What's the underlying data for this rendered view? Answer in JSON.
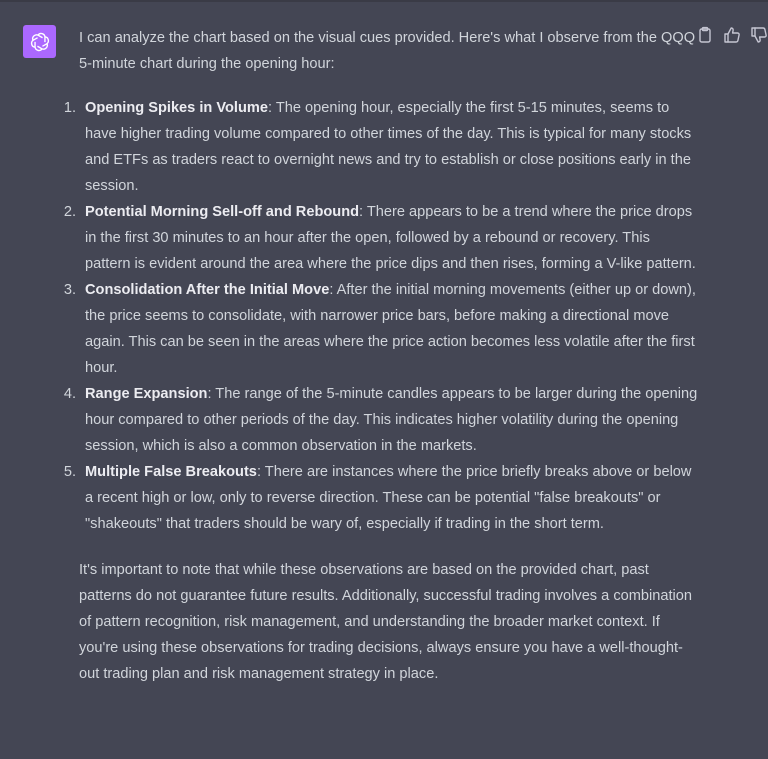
{
  "assistant": {
    "avatar_icon": "openai-logo-icon",
    "avatar_color": "#ab68ff"
  },
  "actions": {
    "copy_icon": "clipboard-icon",
    "like_icon": "thumbs-up-icon",
    "dislike_icon": "thumbs-down-icon"
  },
  "message": {
    "intro": "I can analyze the chart based on the visual cues provided. Here's what I observe from the QQQ 5-minute chart during the opening hour:",
    "points": [
      {
        "number": "1.",
        "title": "Opening Spikes in Volume",
        "text": ": The opening hour, especially the first 5-15 minutes, seems to have higher trading volume compared to other times of the day. This is typical for many stocks and ETFs as traders react to overnight news and try to establish or close positions early in the session."
      },
      {
        "number": "2.",
        "title": "Potential Morning Sell-off and Rebound",
        "text": ": There appears to be a trend where the price drops in the first 30 minutes to an hour after the open, followed by a rebound or recovery. This pattern is evident around the area where the price dips and then rises, forming a V-like pattern."
      },
      {
        "number": "3.",
        "title": "Consolidation After the Initial Move",
        "text": ": After the initial morning movements (either up or down), the price seems to consolidate, with narrower price bars, before making a directional move again. This can be seen in the areas where the price action becomes less volatile after the first hour."
      },
      {
        "number": "4.",
        "title": "Range Expansion",
        "text": ": The range of the 5-minute candles appears to be larger during the opening hour compared to other periods of the day. This indicates higher volatility during the opening session, which is also a common observation in the markets."
      },
      {
        "number": "5.",
        "title": "Multiple False Breakouts",
        "text": ": There are instances where the price briefly breaks above or below a recent high or low, only to reverse direction. These can be potential \"false breakouts\" or \"shakeouts\" that traders should be wary of, especially if trading in the short term."
      }
    ],
    "closing": "It's important to note that while these observations are based on the provided chart, past patterns do not guarantee future results. Additionally, successful trading involves a combination of pattern recognition, risk management, and understanding the broader market context. If you're using these observations for trading decisions, always ensure you have a well-thought-out trading plan and risk management strategy in place."
  }
}
